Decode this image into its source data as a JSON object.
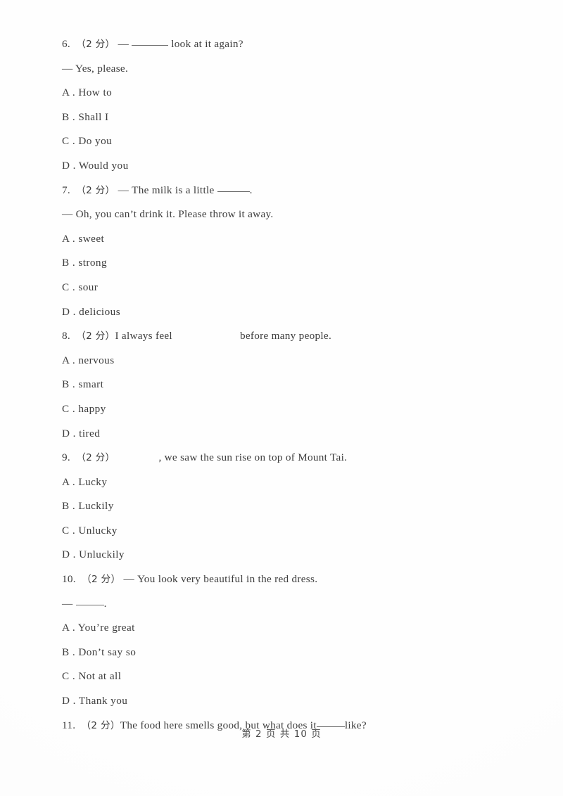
{
  "document": {
    "page_footer": "第 2 页 共 10 页",
    "current_page": "2",
    "total_pages": "10"
  },
  "questions": [
    {
      "number": "6.",
      "marks": "（2 分）",
      "stem_prefix": "— ",
      "stem_before_blank": "",
      "blank": "______",
      "stem_after_blank": " look at it again?",
      "second_line": "— Yes, please.",
      "options": [
        {
          "letter": "A",
          "sep": " . ",
          "text": "How to"
        },
        {
          "letter": "B",
          "sep": " . ",
          "text": "Shall I"
        },
        {
          "letter": "C",
          "sep": " . ",
          "text": "Do you"
        },
        {
          "letter": "D",
          "sep": " . ",
          "text": "Would you"
        }
      ]
    },
    {
      "number": "7.",
      "marks": "（2 分）",
      "stem_prefix": "— ",
      "stem_before_blank": "The milk is a little ",
      "blank": "______",
      "stem_after_blank": ".",
      "second_line": "— Oh, you can’t drink it. Please throw it away.",
      "options": [
        {
          "letter": "A",
          "sep": " . ",
          "text": "sweet"
        },
        {
          "letter": "B",
          "sep": " . ",
          "text": "strong"
        },
        {
          "letter": "C",
          "sep": " . ",
          "text": "sour"
        },
        {
          "letter": "D",
          "sep": " . ",
          "text": "delicious"
        }
      ]
    },
    {
      "number": "8.",
      "marks": "（2 分）",
      "stem_prefix": "",
      "stem_before_blank": "I always feel",
      "blank": "",
      "stem_after_blank": "before many people.",
      "second_line": "",
      "options": [
        {
          "letter": "A",
          "sep": " . ",
          "text": "nervous"
        },
        {
          "letter": "B",
          "sep": " . ",
          "text": "smart"
        },
        {
          "letter": "C",
          "sep": " . ",
          "text": "happy"
        },
        {
          "letter": "D",
          "sep": " . ",
          "text": "tired"
        }
      ]
    },
    {
      "number": "9.",
      "marks": "（2 分）",
      "stem_prefix": "",
      "stem_before_blank": "",
      "blank": "",
      "stem_after_blank": ", we saw the sun rise on top of Mount Tai.",
      "second_line": "",
      "options": [
        {
          "letter": "A",
          "sep": " . ",
          "text": "Lucky"
        },
        {
          "letter": "B",
          "sep": " . ",
          "text": "Luckily"
        },
        {
          "letter": "C",
          "sep": " . ",
          "text": "Unlucky"
        },
        {
          "letter": "D",
          "sep": " . ",
          "text": "Unluckily"
        }
      ]
    },
    {
      "number": "10.",
      "marks": "（2 分）",
      "stem_prefix": "— ",
      "stem_before_blank": "You look very beautiful in the red dress.",
      "blank": "",
      "stem_after_blank": "",
      "second_line_prefix": "— ",
      "second_line_blank": "______",
      "second_line_suffix": ".",
      "options": [
        {
          "letter": "A",
          "sep": " . ",
          "text": "You’re great"
        },
        {
          "letter": "B",
          "sep": " . ",
          "text": "Don’t say so"
        },
        {
          "letter": "C",
          "sep": " . ",
          "text": "Not at all"
        },
        {
          "letter": "D",
          "sep": " . ",
          "text": "Thank you"
        }
      ]
    },
    {
      "number": "11.",
      "marks": "（2 分）",
      "stem_prefix": "",
      "stem_before_blank": "The food here smells good, but what does it",
      "blank": "_____",
      "stem_after_blank": "like?",
      "second_line": "",
      "options": []
    }
  ]
}
